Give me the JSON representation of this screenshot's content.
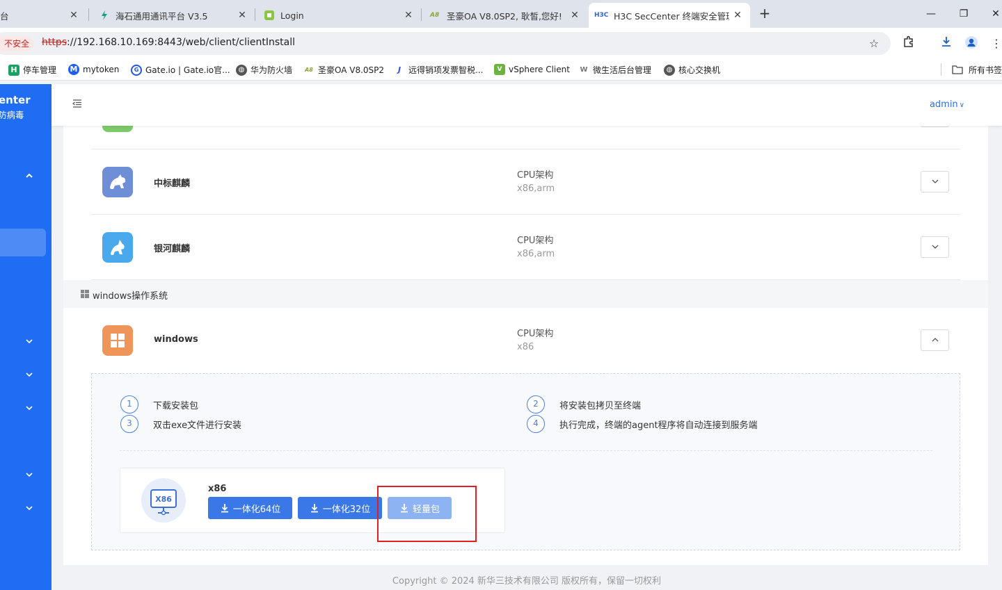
{
  "browser": {
    "tabs": [
      {
        "title": "台",
        "icon": "tab-favicon"
      },
      {
        "title": "海石通用通讯平台 V3.5",
        "icon": "lightning-icon"
      },
      {
        "title": "Login",
        "icon": "green-square-icon"
      },
      {
        "title": "圣豪OA V8.0SP2, 耿皙,您好!",
        "icon": "a8-icon"
      },
      {
        "title": "H3C SecCenter 终端安全管理…",
        "icon": "h3c-icon",
        "active": true
      }
    ],
    "security_label": "不安全",
    "url_scheme": "https",
    "url_rest": "://192.168.10.169:8443/web/client/clientInstall",
    "bookmarks": [
      {
        "label": "停车管理",
        "icon": "H",
        "color": "#1aa260"
      },
      {
        "label": "mytoken",
        "icon": "M",
        "color": "#1f5cf0"
      },
      {
        "label": "Gate.io | Gate.io官...",
        "icon": "G",
        "color": "#2354e6"
      },
      {
        "label": "华为防火墙",
        "icon": "globe-icon",
        "color": "#555555"
      },
      {
        "label": "圣豪OA V8.0SP2",
        "icon": "A8",
        "color": "#8aa63a"
      },
      {
        "label": "远得销项发票智税...",
        "icon": "J",
        "color": "#2b53d6"
      },
      {
        "label": "vSphere Client",
        "icon": "V",
        "color": "#6db33f"
      },
      {
        "label": "微生活后台管理",
        "icon": "W",
        "color": "#777777"
      },
      {
        "label": "核心交换机",
        "icon": "globe-icon",
        "color": "#555555"
      }
    ],
    "all_bookmarks": "所有书签"
  },
  "app": {
    "brand_line1": "enter",
    "brand_line2": "防病毒",
    "user": "admin",
    "os_items": [
      {
        "name": "中标麒麟",
        "cpu_label": "CPU架构",
        "cpu": "x86,arm",
        "color": "#6e8fd6",
        "expanded": false
      },
      {
        "name": "银河麒麟",
        "cpu_label": "CPU架构",
        "cpu": "x86,arm",
        "color": "#4aa8ec",
        "expanded": false
      }
    ],
    "partial_cpu": "x86",
    "section_title": "windows操作系统",
    "windows_item": {
      "name": "windows",
      "cpu_label": "CPU架构",
      "cpu": "x86",
      "color": "#f0955a",
      "expanded": true
    },
    "steps": [
      {
        "num": "1",
        "text": "下载安装包"
      },
      {
        "num": "2",
        "text": "将安装包拷贝至终端"
      },
      {
        "num": "3",
        "text": "双击exe文件进行安装"
      },
      {
        "num": "4",
        "text": "执行完成，终端的agent程序将自动连接到服务端"
      }
    ],
    "package": {
      "badge": "X86",
      "arch": "x86",
      "buttons": [
        "一体化64位",
        "一体化32位",
        "轻量包"
      ]
    },
    "footer": "Copyright © 2024 新华三技术有限公司 版权所有，保留一切权利"
  },
  "colors": {
    "sidebar": "#1f6df2",
    "primary": "#3b78e7",
    "highlight_box": "#e02020"
  }
}
